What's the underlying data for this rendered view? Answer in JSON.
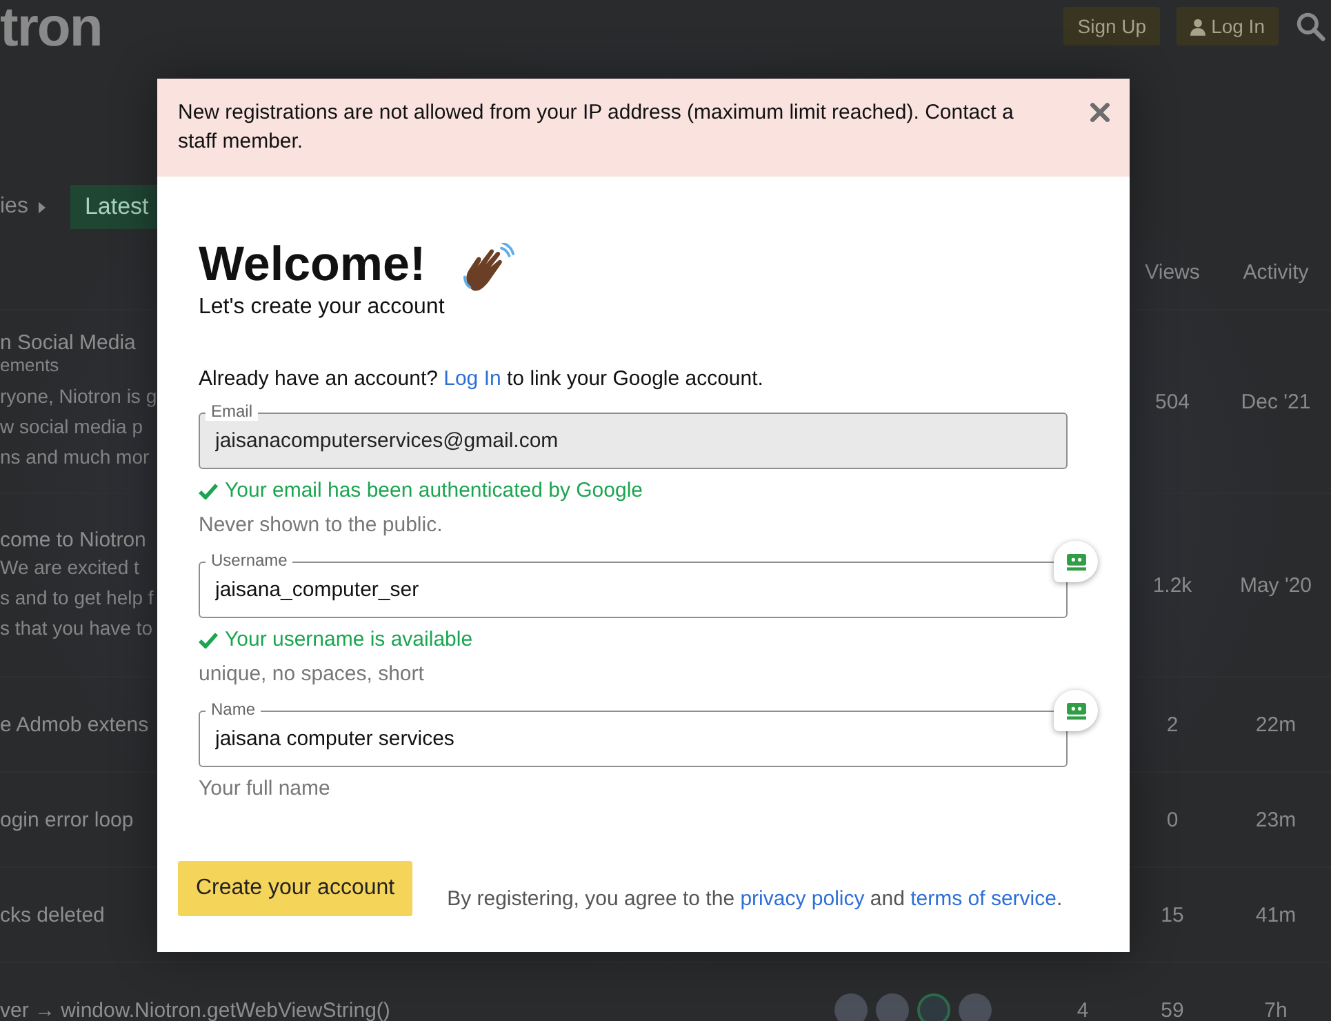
{
  "header": {
    "logo": "tron",
    "buttons": [
      {
        "label": "Sign Up",
        "kind": "plain"
      },
      {
        "label": "Log In",
        "kind": "user"
      }
    ]
  },
  "nav": {
    "breadcrumb": "ies",
    "tabs": [
      {
        "label": "Latest",
        "selected": true
      }
    ]
  },
  "topic_list": {
    "columns": [
      "Views",
      "Activity"
    ],
    "rows": [
      {
        "title": "n Social Media",
        "category": "ements",
        "excerpt": [
          "ryone, Niotron is g",
          "w social media p",
          "ns and much mor"
        ],
        "views": "504",
        "activity": "Dec '21"
      },
      {
        "title": "come to Niotron",
        "excerpt": [
          "We are excited t",
          "s and to get help f",
          "s that you have to"
        ],
        "views": "1.2k",
        "activity": "May '20"
      },
      {
        "title": "e Admob extens",
        "views": "2",
        "activity": "22m"
      },
      {
        "title": "ogin error loop",
        "views": "0",
        "activity": "23m"
      },
      {
        "title": "cks deleted",
        "views": "15",
        "activity": "41m"
      },
      {
        "title": "ver → window.Niotron.getWebViewString()",
        "posters": [
          {
            "kind": "photo"
          },
          {
            "kind": "photo"
          },
          {
            "kind": "logo"
          },
          {
            "kind": "photo"
          }
        ],
        "replies": "4",
        "views": "59",
        "activity": "7h"
      }
    ]
  },
  "modal": {
    "alert": "New registrations are not allowed from your IP address (maximum limit reached). Contact a staff member.",
    "title": "Welcome!",
    "subtitle": "Let's create your account",
    "login_prompt": {
      "before": "Already have an account?",
      "link": "Log In",
      "after": "to link your Google account."
    },
    "fields": [
      {
        "label": "Email",
        "value": "jaisanacomputerservices@gmail.com",
        "disabled": true,
        "autofill": false,
        "status": "Your email has been authenticated by Google",
        "hint": "Never shown to the public."
      },
      {
        "label": "Username",
        "value": "jaisana_computer_ser",
        "disabled": false,
        "autofill": true,
        "status": "Your username is available",
        "hint": "unique, no spaces, short"
      },
      {
        "label": "Name",
        "value": "jaisana computer services",
        "disabled": false,
        "autofill": true,
        "hint": "Your full name"
      }
    ],
    "submit": "Create your account",
    "terms": {
      "before": "By registering, you agree to the",
      "link1": "privacy policy",
      "middle": "and",
      "link2": "terms of service",
      "after": "."
    }
  }
}
